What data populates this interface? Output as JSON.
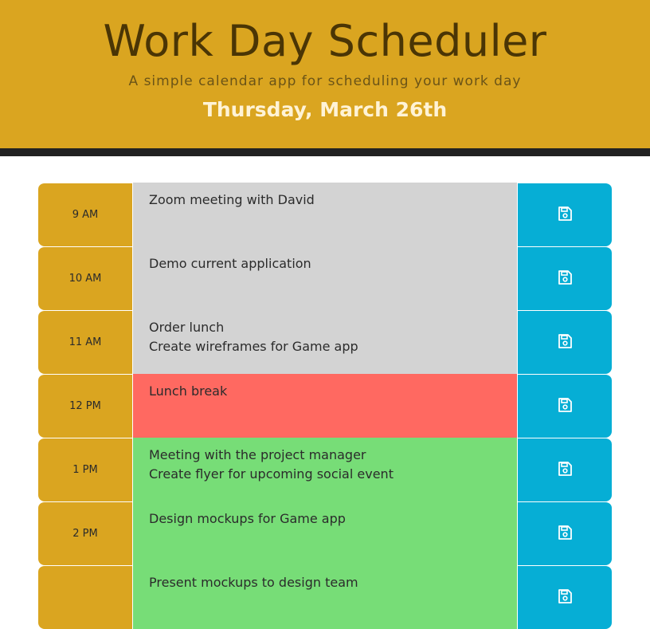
{
  "header": {
    "title": "Work Day Scheduler",
    "subtitle": "A simple calendar app for scheduling your work day",
    "current_day": "Thursday, March 26th"
  },
  "colors": {
    "header_bg": "#daa520",
    "past": "#d3d3d3",
    "present": "#ff6961",
    "future": "#77dd77",
    "save": "#06aed5"
  },
  "rows": [
    {
      "hour": "9 AM",
      "text": "Zoom meeting with David",
      "state": "past"
    },
    {
      "hour": "10 AM",
      "text": "Demo current application",
      "state": "past"
    },
    {
      "hour": "11 AM",
      "text": "Order lunch\nCreate wireframes for Game app",
      "state": "past"
    },
    {
      "hour": "12 PM",
      "text": "Lunch break",
      "state": "present"
    },
    {
      "hour": "1 PM",
      "text": "Meeting with the project manager\nCreate flyer for upcoming social event",
      "state": "future"
    },
    {
      "hour": "2 PM",
      "text": "Design mockups for Game app",
      "state": "future"
    },
    {
      "hour": "",
      "text": "Present mockups to design team",
      "state": "future"
    }
  ],
  "save_icon": "save-icon"
}
